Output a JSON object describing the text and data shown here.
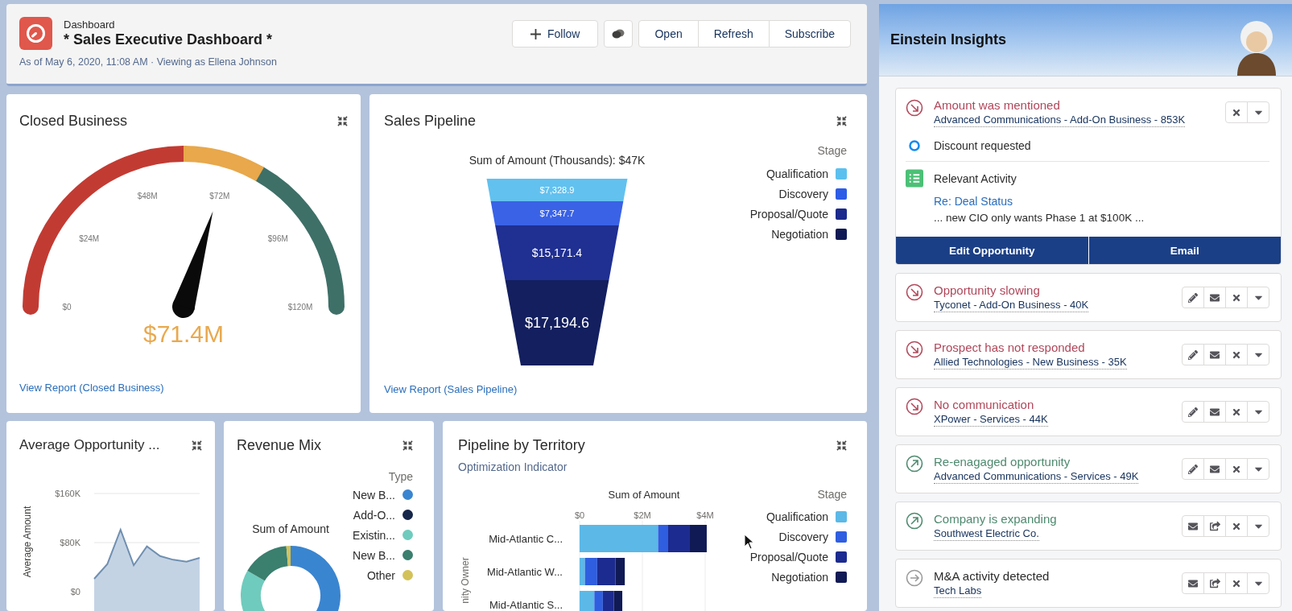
{
  "header": {
    "breadcrumb": "Dashboard",
    "title": "* Sales Executive Dashboard *",
    "meta": "As of May 6, 2020, 11:08 AM · Viewing as Ellena Johnson",
    "follow": "Follow",
    "buttons": [
      "Open",
      "Refresh",
      "Subscribe"
    ]
  },
  "closed_business": {
    "title": "Closed Business",
    "ticks": [
      "$0",
      "$24M",
      "$48M",
      "$72M",
      "$96M",
      "$120M"
    ],
    "needle": {
      "level": 0.595
    },
    "value": "$71.4M",
    "link": "View Report (Closed Business)"
  },
  "sales_pipeline": {
    "title": "Sales Pipeline",
    "caption": "Sum of Amount (Thousands): $47K",
    "segments": [
      {
        "label": "$7,328.9",
        "color": "#62c1ef"
      },
      {
        "label": "$7,347.7",
        "color": "#3a62e6"
      },
      {
        "label": "$15,171.4",
        "color": "#1f2f92"
      },
      {
        "label": "$17,194.6",
        "color": "#131f5e"
      }
    ],
    "legend_title": "Stage",
    "legend": [
      {
        "label": "Qualification",
        "color": "#5cc0ef"
      },
      {
        "label": "Discovery",
        "color": "#2d5ce6"
      },
      {
        "label": "Proposal/Quote",
        "color": "#1b2a8c"
      },
      {
        "label": "Negotiation",
        "color": "#0f1a54"
      }
    ],
    "link": "View Report (Sales Pipeline)"
  },
  "average_opportunity": {
    "title": "Average Opportunity ...",
    "chart_data": {
      "type": "area",
      "ylabel": "Average Amount",
      "ylim": [
        0,
        160
      ],
      "yticks": [
        {
          "value": 0,
          "label": "$0"
        },
        {
          "value": 80,
          "label": "$80K"
        },
        {
          "value": 160,
          "label": "$160K"
        }
      ],
      "values": [
        21,
        45,
        101,
        43,
        74,
        58,
        52,
        49,
        55
      ]
    }
  },
  "revenue_mix": {
    "title": "Revenue Mix",
    "caption": "Sum of Amount",
    "legend_title": "Type",
    "legend": [
      {
        "label": "New B...",
        "color": "#3a85d0"
      },
      {
        "label": "Add-O...",
        "color": "#16264a"
      },
      {
        "label": "Existin...",
        "color": "#6fcbbd"
      },
      {
        "label": "New B...",
        "color": "#3b7f6e"
      },
      {
        "label": "Other",
        "color": "#d3c25a"
      }
    ]
  },
  "pipeline_by_territory": {
    "title": "Pipeline by Territory",
    "subtitle": "Optimization Indicator",
    "chart_data": {
      "type": "bar",
      "orientation": "horizontal",
      "stacked": true,
      "title": "Sum of Amount",
      "ylabel": "nity Owner",
      "categories": [
        "Mid-Atlantic C...",
        "Mid-Atlantic W...",
        "Mid-Atlantic S..."
      ],
      "xlim": [
        0,
        4.1
      ],
      "xticks": [
        {
          "value": 0,
          "label": "$0"
        },
        {
          "value": 2,
          "label": "$2M"
        },
        {
          "value": 4,
          "label": "$4M"
        }
      ],
      "legend": {
        "title": "Stage"
      },
      "series": [
        {
          "name": "Qualification",
          "color": "#5cb8e6",
          "values": [
            2.5,
            0.17,
            0.47
          ]
        },
        {
          "name": "Discovery",
          "color": "#2f5ee0",
          "values": [
            0.32,
            0.39,
            0.27
          ]
        },
        {
          "name": "Proposal/Quote",
          "color": "#1c2b8f",
          "values": [
            0.67,
            0.58,
            0.35
          ]
        },
        {
          "name": "Negotiation",
          "color": "#101a55",
          "values": [
            0.56,
            0.3,
            0.27
          ]
        }
      ]
    }
  },
  "einstein_insights": {
    "title": "Einstein Insights",
    "items": [
      {
        "kind": "negative",
        "title": "Amount was mentioned",
        "subtitle": "Advanced Communications - Add-On Business - 853K",
        "expanded": true,
        "actions": [
          {
            "kind": "dismiss"
          },
          {
            "kind": "more"
          }
        ],
        "details": {
          "note": "Discount requested",
          "activity_title": "Relevant Activity",
          "activity_link": "Re: Deal Status",
          "activity_snippet": "... new CIO only wants Phase 1 at $100K ...",
          "buttons": [
            "Edit Opportunity",
            "Email"
          ]
        }
      },
      {
        "kind": "negative",
        "title": "Opportunity slowing",
        "subtitle": "Tyconet - Add-On Business - 40K",
        "expanded": false,
        "actions": [
          {
            "kind": "edit"
          },
          {
            "kind": "email"
          },
          {
            "kind": "dismiss"
          },
          {
            "kind": "more"
          }
        ]
      },
      {
        "kind": "negative",
        "title": "Prospect has not responded",
        "subtitle": "Allied Technologies - New Business - 35K",
        "expanded": false,
        "actions": [
          {
            "kind": "edit"
          },
          {
            "kind": "email"
          },
          {
            "kind": "dismiss"
          },
          {
            "kind": "more"
          }
        ]
      },
      {
        "kind": "negative",
        "title": "No communication",
        "subtitle": "XPower - Services - 44K",
        "expanded": false,
        "actions": [
          {
            "kind": "edit"
          },
          {
            "kind": "email"
          },
          {
            "kind": "dismiss"
          },
          {
            "kind": "more"
          }
        ]
      },
      {
        "kind": "positive",
        "title": "Re-enagaged opportunity",
        "subtitle": "Advanced Communications - Services - 49K",
        "expanded": false,
        "actions": [
          {
            "kind": "edit"
          },
          {
            "kind": "email"
          },
          {
            "kind": "dismiss"
          },
          {
            "kind": "more"
          }
        ]
      },
      {
        "kind": "positive",
        "title": "Company is expanding",
        "subtitle": "Southwest Electric Co.",
        "expanded": false,
        "actions": [
          {
            "kind": "email"
          },
          {
            "kind": "share"
          },
          {
            "kind": "dismiss"
          },
          {
            "kind": "more"
          }
        ]
      },
      {
        "kind": "neutral",
        "title": "M&A activity detected",
        "subtitle": "Tech Labs",
        "expanded": false,
        "actions": [
          {
            "kind": "email"
          },
          {
            "kind": "share"
          },
          {
            "kind": "dismiss"
          },
          {
            "kind": "more"
          }
        ]
      }
    ]
  }
}
